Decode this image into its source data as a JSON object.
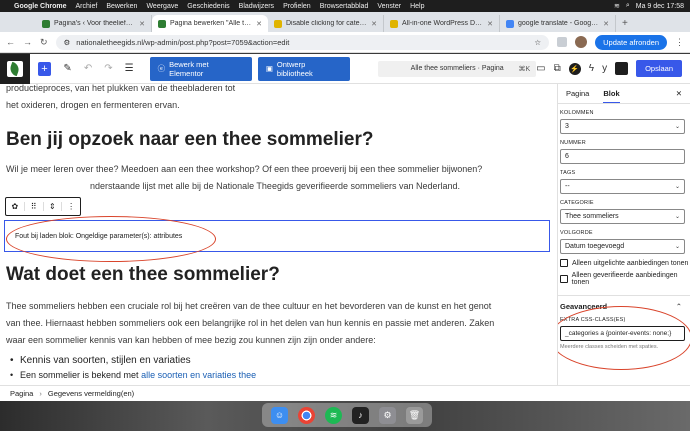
{
  "menubar": {
    "items": [
      "Google Chrome",
      "Archief",
      "Bewerken",
      "Weergave",
      "Geschiedenis",
      "Bladwijzers",
      "Profielen",
      "Browsertabblad",
      "Venster",
      "Help"
    ],
    "datetime": "Ma 9 dec 17:58"
  },
  "tabs": [
    {
      "title": "Pagina's ‹ Voor theeliefhebbe",
      "color": "#2e7d32",
      "active": false
    },
    {
      "title": "Pagina bewerken \"Alle thee s",
      "color": "#2e7d32",
      "active": true
    },
    {
      "title": "Disable clicking for categorie",
      "color": "#e0b400",
      "active": false
    },
    {
      "title": "All-in-one WordPress Director",
      "color": "#e0b400",
      "active": false
    },
    {
      "title": "google translate - Google Sea",
      "color": "#4285f4",
      "active": false
    }
  ],
  "address": {
    "url": "nationaletheegids.nl/wp-admin/post.php?post=7059&action=edit",
    "update_label": "Update afronden"
  },
  "toolbar": {
    "elementor_label": "Bewerk met Elementor",
    "library_label": "Ontwerp bibliotheek",
    "document_title": "Alle thee sommeliers · Pagina",
    "shortcut": "⌘K",
    "save_label": "Opslaan"
  },
  "content": {
    "intro_paragraph": "productieproces, van het plukken van de theebladeren tot\nhet oxideren, drogen en fermenteren ervan.",
    "heading1": "Ben jij opzoek naar een thee sommelier?",
    "para1_line1": "Wil je meer leren over thee? Meedoen aan een thee workshop? Of een thee proeverij bij een thee sommelier bijwonen?",
    "para1_line2": "nderstaande lijst met alle bij de Nationale Theegids geverifieerde sommeliers van Nederland.",
    "error_text": "Fout bij laden blok: Ongeldige parameter(s): attributes",
    "heading2": "Wat doet een thee sommelier?",
    "para2_line1": "Thee sommeliers hebben een cruciale rol bij het creëren van de thee cultuur en het bevorderen van de kunst en het genot",
    "para2_line2": "van thee. Hiernaast hebben sommeliers ook een belangrijke rol in het delen van hun kennis en passie met anderen. Zaken",
    "para2_line3": "waar een sommelier kennis van kan hebben of mee bezig zou kunnen zijn zijn onder andere:",
    "list_item1": "Kennis van soorten, stijlen en variaties",
    "list_item1_sub_prefix": "Een sommelier is bekend met ",
    "list_item1_sub_link": "alle soorten en variaties thee"
  },
  "footer": {
    "crumb1": "Pagina",
    "crumb2": "Gegevens vermelding(en)"
  },
  "sidebar": {
    "tab_page": "Pagina",
    "tab_block": "Blok",
    "kolommen_label": "KOLOMMEN",
    "kolommen_value": "3",
    "nummer_label": "NUMMER",
    "nummer_value": "6",
    "tags_label": "TAGS",
    "tags_value": "--",
    "categorie_label": "CATEGORIE",
    "categorie_value": "Thee sommeliers",
    "volgorde_label": "VOLGORDE",
    "volgorde_value": "Datum toegevoegd",
    "check1": "Alleen uitgelichte aanbiedingen tonen",
    "check2": "Alleen geverifieerde aanbiedingen tonen",
    "advanced_label": "Geavanceerd",
    "css_label": "EXTRA CSS-CLASS(ES)",
    "css_value": "_categories a {pointer-events: none;}",
    "css_help": "Meerdere classes scheiden met spaties."
  },
  "dock": [
    {
      "name": "finder",
      "color": "#3d8ef0"
    },
    {
      "name": "chrome",
      "color": "#ea4335"
    },
    {
      "name": "spotify",
      "color": "#1db954"
    },
    {
      "name": "music",
      "color": "#222222"
    },
    {
      "name": "settings",
      "color": "#8e8e93"
    },
    {
      "name": "trash",
      "color": "#9a9a9a"
    }
  ]
}
